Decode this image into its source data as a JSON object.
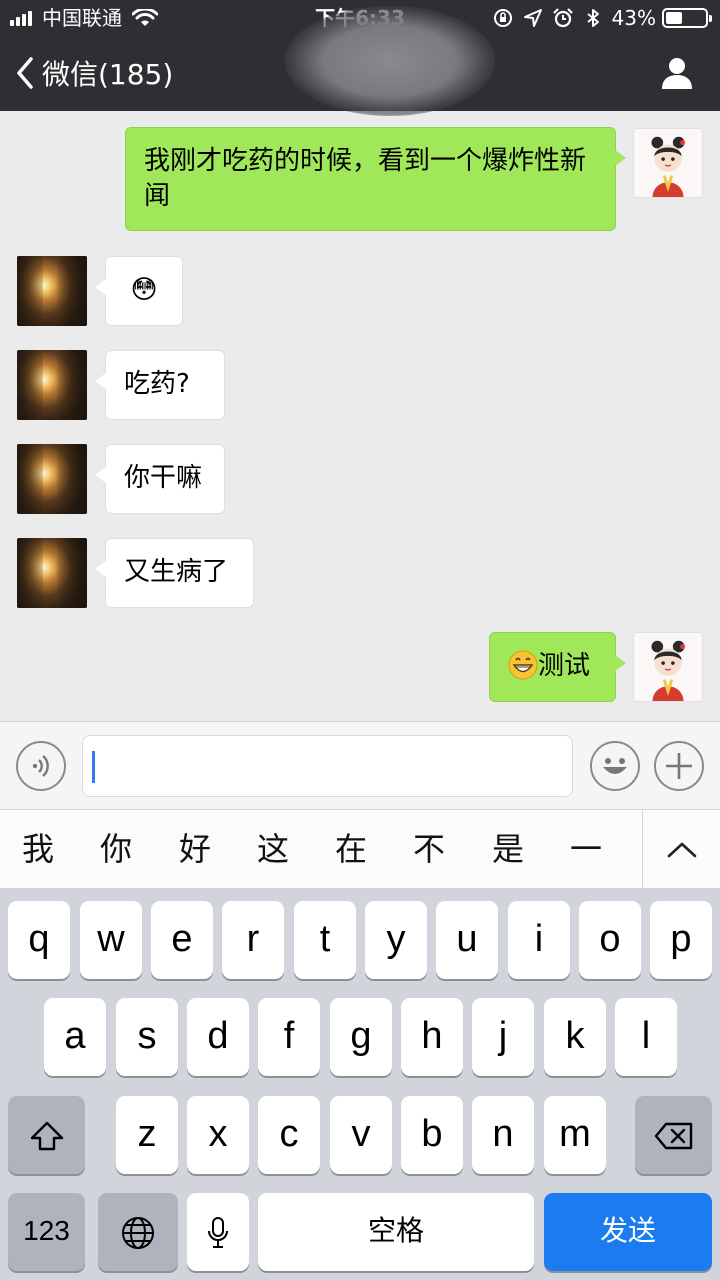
{
  "status_bar": {
    "carrier": "中国联通",
    "time": "下午6:33",
    "battery_percent": "43%",
    "battery_level": 0.43
  },
  "nav": {
    "back_label": "微信(185)",
    "back_icon": "chevron-left-icon",
    "profile_icon": "person-icon"
  },
  "messages": [
    {
      "from": "me",
      "text": "我刚才吃药的时候，看到一个爆炸性新闻"
    },
    {
      "from": "other",
      "text": "😳"
    },
    {
      "from": "other",
      "text": "吃药?"
    },
    {
      "from": "other",
      "text": "你干嘛"
    },
    {
      "from": "other",
      "text": "又生病了"
    },
    {
      "from": "me",
      "text": "测试",
      "emoji_icon": "grinning-face-icon"
    }
  ],
  "input_bar": {
    "value": "",
    "voice_icon": "voice-icon",
    "emoji_icon": "smiley-icon",
    "plus_icon": "plus-icon"
  },
  "candidates": [
    "我",
    "你",
    "好",
    "这",
    "在",
    "不",
    "是",
    "一"
  ],
  "keyboard": {
    "row1": [
      "q",
      "w",
      "e",
      "r",
      "t",
      "y",
      "u",
      "i",
      "o",
      "p"
    ],
    "row2": [
      "a",
      "s",
      "d",
      "f",
      "g",
      "h",
      "j",
      "k",
      "l"
    ],
    "row3": [
      "z",
      "x",
      "c",
      "v",
      "b",
      "n",
      "m"
    ],
    "numbers_label": "123",
    "space_label": "空格",
    "send_label": "发送",
    "send_color": "#1b7cf2"
  }
}
